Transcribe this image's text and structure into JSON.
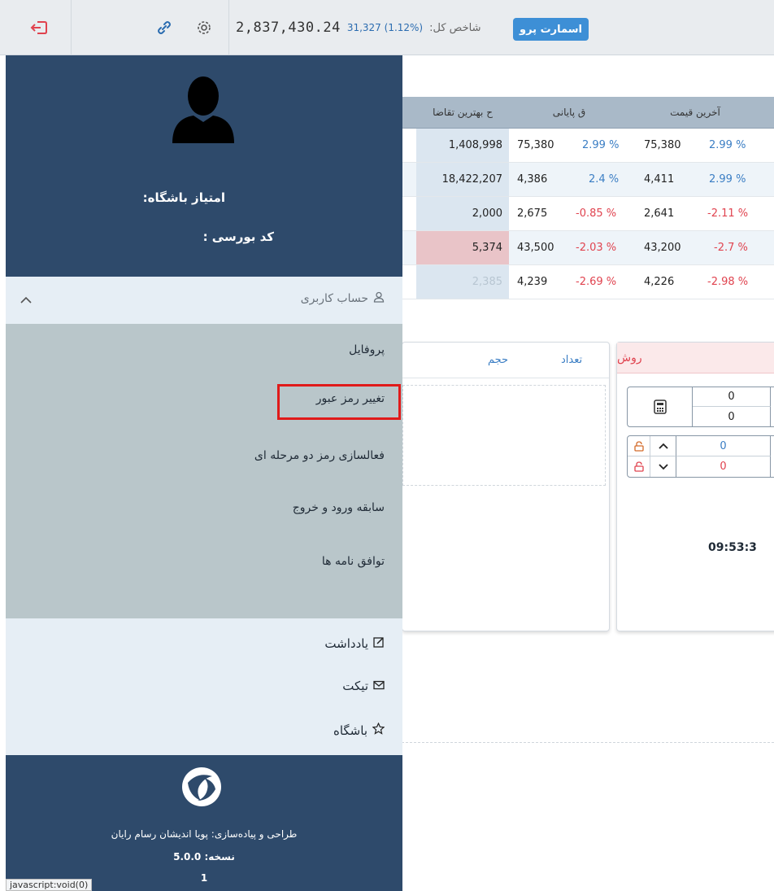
{
  "topbar": {
    "logout_icon": "logout-icon",
    "link_icon": "link-icon",
    "gear_icon": "gear-icon",
    "index_value": "2,837,430.24",
    "index_change": "31,327 (1.12%)",
    "index_label": "شاخص کل:",
    "smart_button": "اسمارت پرو"
  },
  "table": {
    "headers": [
      "ح بهترین تقاضا",
      "ق پایانی",
      "آخرین قیمت"
    ],
    "rows": [
      {
        "bid": "1,408,998",
        "close": "75,380",
        "close_pct": "2.99 %",
        "last": "75,380",
        "last_pct": "2.99 %"
      },
      {
        "bid": "18,422,207",
        "close": "4,386",
        "close_pct": "2.4 %",
        "last": "4,411",
        "last_pct": "2.99 %"
      },
      {
        "bid": "2,000",
        "close": "2,675",
        "close_pct": "-0.85 %",
        "last": "2,641",
        "last_pct": "-2.11 %"
      },
      {
        "bid": "5,374",
        "close": "43,500",
        "close_pct": "-2.03 %",
        "last": "43,200",
        "last_pct": "-2.7 %"
      },
      {
        "bid": "2,385",
        "close": "4,239",
        "close_pct": "-2.69 %",
        "last": "4,226",
        "last_pct": "-2.98 %"
      }
    ]
  },
  "mid_panel": {
    "count_label": "تعداد",
    "volume_label": "حجم"
  },
  "right_panel": {
    "sell_label": "روش",
    "vals": [
      "0",
      "0",
      "0",
      "0"
    ],
    "time": "09:53:3"
  },
  "sidebar": {
    "club_score_label": "امتیاز باشگاه:",
    "bourse_code_label": "کد بورسی :",
    "account_label": "حساب کاربری",
    "submenu": [
      "پروفایل",
      "تغییر رمز عبور",
      "فعالسازی رمز دو مرحله ای",
      "سابقه ورود و خروج",
      "توافق نامه ها"
    ],
    "menu": [
      {
        "label": "یادداشت",
        "icon": "note-edit-icon"
      },
      {
        "label": "تیکت",
        "icon": "envelope-icon"
      },
      {
        "label": "باشگاه",
        "icon": "star-icon"
      }
    ],
    "footer": {
      "credit": "طراحی و پیادەسازی: پویا اندیشان رسام رایان",
      "version": "نسخه: 5.0.0",
      "page": "1"
    }
  },
  "status_tip": "javascript:void(0)"
}
